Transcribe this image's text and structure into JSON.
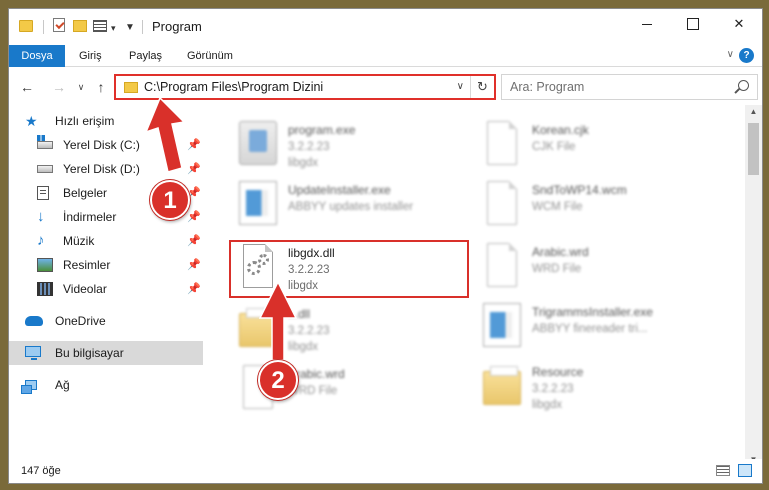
{
  "window": {
    "title": "Program"
  },
  "ribbon": {
    "tabs": [
      "Dosya",
      "Giriş",
      "Paylaş",
      "Görünüm"
    ],
    "help_label": "?"
  },
  "address": {
    "path": "C:\\Program Files\\Program Dizini"
  },
  "search": {
    "placeholder": "Ara: Program"
  },
  "sidebar": {
    "items": [
      {
        "label": "Hızlı erişim",
        "icon": "star-icon"
      },
      {
        "label": "Yerel Disk (C:)",
        "icon": "drive-icon",
        "pinned": true
      },
      {
        "label": "Yerel Disk (D:)",
        "icon": "drive-icon",
        "pinned": true
      },
      {
        "label": "Belgeler",
        "icon": "documents-icon",
        "pinned": true
      },
      {
        "label": "İndirmeler",
        "icon": "downloads-icon",
        "pinned": true
      },
      {
        "label": "Müzik",
        "icon": "music-icon",
        "pinned": true
      },
      {
        "label": "Resimler",
        "icon": "pictures-icon",
        "pinned": true
      },
      {
        "label": "Videolar",
        "icon": "videos-icon",
        "pinned": true
      },
      {
        "label": "OneDrive",
        "icon": "onedrive-icon"
      },
      {
        "label": "Bu bilgisayar",
        "icon": "this-pc-icon",
        "selected": true
      },
      {
        "label": "Ağ",
        "icon": "network-icon"
      }
    ]
  },
  "files": {
    "left": [
      {
        "name": "program.exe",
        "line2": "3.2.2.23",
        "line3": "libgdx",
        "icon": "exe-icon"
      },
      {
        "name": "UpdateInstaller.exe",
        "line2": "ABBYY updates installer",
        "line3": "",
        "icon": "installer-icon"
      },
      {
        "name": "libgdx.dll",
        "line2": "3.2.2.23",
        "line3": "libgdx",
        "icon": "dll-gear-icon"
      },
      {
        "name": "...dll",
        "line2": "3.2.2.23",
        "line3": "libgdx",
        "icon": "folder-icon"
      },
      {
        "name": "Arabic.wrd",
        "line2": "WRD File",
        "line3": "",
        "icon": "file-icon"
      }
    ],
    "right": [
      {
        "name": "Korean.cjk",
        "line2": "CJK File",
        "line3": "",
        "icon": "file-icon"
      },
      {
        "name": "SndToWP14.wcm",
        "line2": "WCM File",
        "line3": "",
        "icon": "file-icon"
      },
      {
        "name": "Arabic.wrd",
        "line2": "WRD File",
        "line3": "",
        "icon": "file-icon"
      },
      {
        "name": "TrigrammsInstaller.exe",
        "line2": "ABBYY finereader tri...",
        "line3": "",
        "icon": "installer-icon"
      },
      {
        "name": "Resource",
        "line2": "3.2.2.23",
        "line3": "libgdx",
        "icon": "folder-icon"
      }
    ]
  },
  "annotations": {
    "badge1": "1",
    "badge2": "2",
    "color": "#d9302a"
  },
  "status": {
    "count": "147 öğe"
  }
}
